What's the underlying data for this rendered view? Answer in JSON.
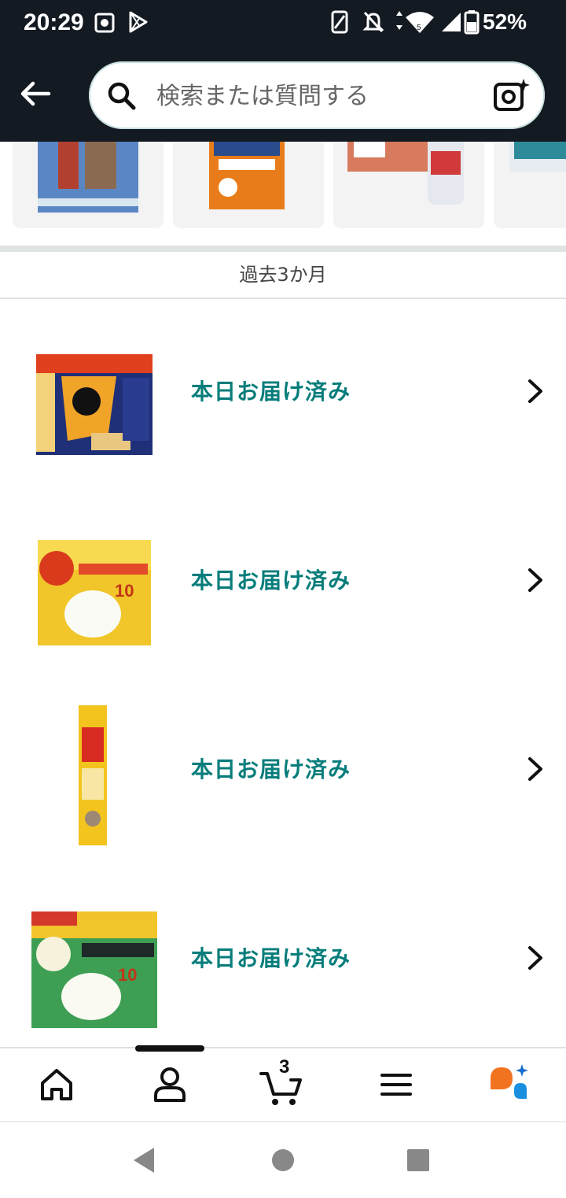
{
  "status_bar": {
    "time": "20:29",
    "battery": "52%",
    "icons": [
      "settings-icon",
      "play-store-icon",
      "vibrate-icon",
      "mute-icon",
      "data-arrows-icon",
      "wifi-icon",
      "signal-icon",
      "battery-icon"
    ]
  },
  "search": {
    "placeholder": "検索または質問する",
    "back_icon": "back-arrow-icon",
    "search_icon": "search-icon",
    "camera_icon": "camera-sparkle-icon"
  },
  "section": {
    "title": "過去3か月"
  },
  "orders": [
    {
      "status": "本日お届け済み",
      "image": "felix-cat-food-box"
    },
    {
      "status": "本日お届け済み",
      "image": "inaba-yaki-chicken-mix"
    },
    {
      "status": "本日お届け済み",
      "image": "cat-paste-tube"
    },
    {
      "status": "本日お届け済み",
      "image": "inaba-yaki-seafood-shirasu"
    }
  ],
  "bottom_nav": {
    "cart_count": "3",
    "items": [
      "home-icon",
      "account-icon",
      "cart-icon",
      "menu-icon",
      "rufus-ai-icon"
    ]
  },
  "colors": {
    "header_bg": "#131a22",
    "status_link": "#067d7b",
    "divider": "#dfe3e3"
  }
}
